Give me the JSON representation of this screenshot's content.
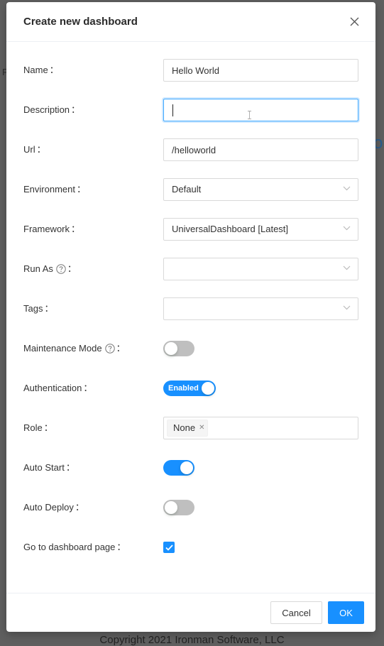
{
  "background": {
    "left_fragment": "P",
    "right_fragment": "oi",
    "footer": "Copyright 2021 Ironman Software, LLC"
  },
  "modal": {
    "title": "Create new dashboard",
    "close_symbol": "X"
  },
  "form": {
    "name": {
      "label": "Name",
      "value": "Hello World"
    },
    "description": {
      "label": "Description",
      "value": "",
      "focused": true
    },
    "url": {
      "label": "Url",
      "value": "/helloworld"
    },
    "environment": {
      "label": "Environment",
      "value": "Default"
    },
    "framework": {
      "label": "Framework",
      "value": "UniversalDashboard [Latest]"
    },
    "run_as": {
      "label": "Run As",
      "value": "",
      "has_help": true
    },
    "tags": {
      "label": "Tags",
      "value": ""
    },
    "maintenance_mode": {
      "label": "Maintenance Mode",
      "checked": false,
      "has_help": true
    },
    "authentication": {
      "label": "Authentication",
      "checked": true,
      "on_text": "Enabled"
    },
    "role": {
      "label": "Role",
      "selected": [
        "None"
      ]
    },
    "auto_start": {
      "label": "Auto Start",
      "checked": true
    },
    "auto_deploy": {
      "label": "Auto Deploy",
      "checked": false
    },
    "go_to_dashboard": {
      "label": "Go to dashboard page",
      "checked": true
    },
    "label_suffix": "："
  },
  "footer": {
    "cancel_label": "Cancel",
    "ok_label": "OK"
  },
  "colors": {
    "primary": "#1890ff",
    "switch_off": "#bfbfbf",
    "border": "#d9d9d9"
  },
  "icons": {
    "close": "close-icon",
    "dropdown": "chevron-down-icon",
    "help": "question-circle-icon",
    "check": "check-icon"
  }
}
